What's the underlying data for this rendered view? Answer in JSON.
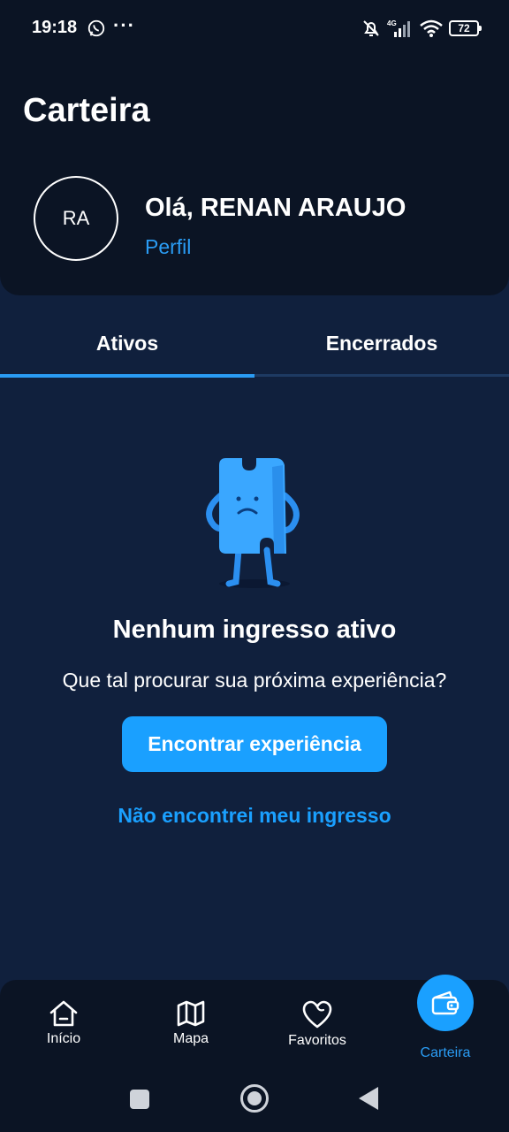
{
  "status_bar": {
    "time": "19:18",
    "dots": "···",
    "network": "4G",
    "battery": "72"
  },
  "header": {
    "title": "Carteira",
    "avatar_initials": "RA",
    "greeting": "Olá, RENAN ARAUJO",
    "profile_link": "Perfil"
  },
  "tabs": [
    {
      "label": "Ativos",
      "active": true
    },
    {
      "label": "Encerrados",
      "active": false
    }
  ],
  "empty_state": {
    "title": "Nenhum ingresso ativo",
    "subtitle": "Que tal procurar sua próxima experiência?",
    "primary_button": "Encontrar experiência",
    "secondary_link": "Não encontrei meu ingresso"
  },
  "bottom_nav": {
    "items": [
      {
        "label": "Início",
        "icon": "home-icon"
      },
      {
        "label": "Mapa",
        "icon": "map-icon"
      },
      {
        "label": "Favoritos",
        "icon": "heart-icon"
      },
      {
        "label": "Carteira",
        "icon": "wallet-icon",
        "active": true
      }
    ]
  },
  "colors": {
    "background": "#10203d",
    "header": "#0b1424",
    "accent": "#1aa0ff"
  }
}
